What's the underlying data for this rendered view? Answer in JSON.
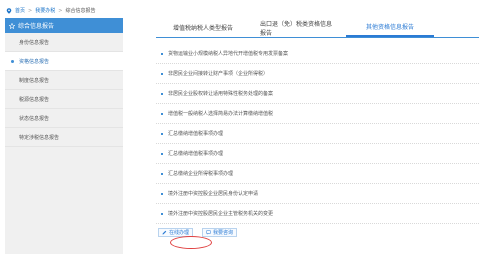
{
  "breadcrumb": {
    "home": "首页",
    "sep1": ">",
    "item2": "我要办税",
    "sep2": ">",
    "current": "综合信息报告"
  },
  "sidebar": {
    "title": "综合信息报告",
    "items": [
      {
        "label": "身份信息报告"
      },
      {
        "label": "资格信息报告"
      },
      {
        "label": "制度信息报告"
      },
      {
        "label": "税源信息报告"
      },
      {
        "label": "状态信息报告"
      },
      {
        "label": "特定涉税信息报告"
      }
    ]
  },
  "tabs": [
    {
      "label": "增值税纳税人类型报告"
    },
    {
      "label": "出口退（免）税类资格信息报告"
    },
    {
      "label": "其他资格信息报告"
    }
  ],
  "list": [
    {
      "label": "货物运输业小规模纳税人异地代开增值税专用发票备案"
    },
    {
      "label": "非居民企业间接转让财产事项（企业所得税）"
    },
    {
      "label": "非居民企业股权转让适用特殊性税务处理的备案"
    },
    {
      "label": "增值税一般纳税人选择简易办法计算缴纳增值税"
    },
    {
      "label": "汇总缴纳增值税事项办理"
    },
    {
      "label": "汇总缴纳增值税事项办理"
    },
    {
      "label": "汇总缴纳企业所得税事项办理"
    },
    {
      "label": "境外注册中资控股企业居民身份认定申请"
    },
    {
      "label": "境外注册中资控股居民企业主管税务机关的变更"
    }
  ],
  "actions": {
    "online": "在线办理",
    "faq": "我要咨询"
  }
}
